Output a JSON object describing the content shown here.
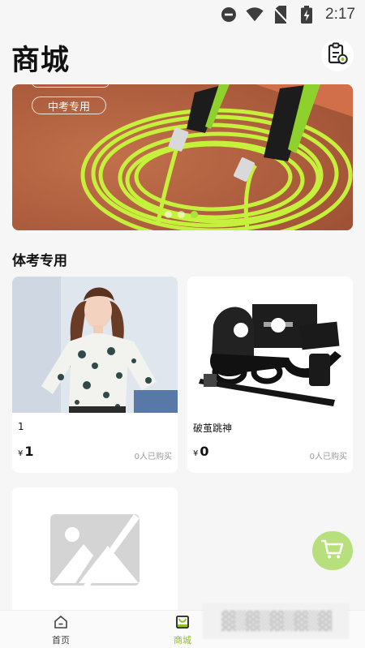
{
  "status_bar": {
    "time": "2:17",
    "icons": [
      "do-not-disturb-icon",
      "wifi-icon",
      "no-sim-icon",
      "battery-charging-icon"
    ]
  },
  "header": {
    "title": "商城",
    "order_icon": "clipboard-order-icon"
  },
  "banner": {
    "tag": "中考专用",
    "slide_count": 3,
    "active_slide": 2
  },
  "section": {
    "title": "体考专用"
  },
  "products": [
    {
      "name": "1",
      "currency": "¥",
      "price": "1",
      "sold": "0人已购买"
    },
    {
      "name": "破茧跳神",
      "currency": "¥",
      "price": "0",
      "sold": "0人已购买"
    },
    {
      "name": "",
      "currency": "",
      "price": "",
      "sold": ""
    }
  ],
  "bottom_nav": {
    "items": [
      {
        "label": "首页",
        "icon": "home-icon",
        "active": false
      },
      {
        "label": "商城",
        "icon": "shop-icon",
        "active": true
      }
    ]
  },
  "colors": {
    "accent": "#8dc21f",
    "cart_fab": "#b7e07d",
    "banner_bg": "#b8613e",
    "rope": "#c5f03c"
  }
}
